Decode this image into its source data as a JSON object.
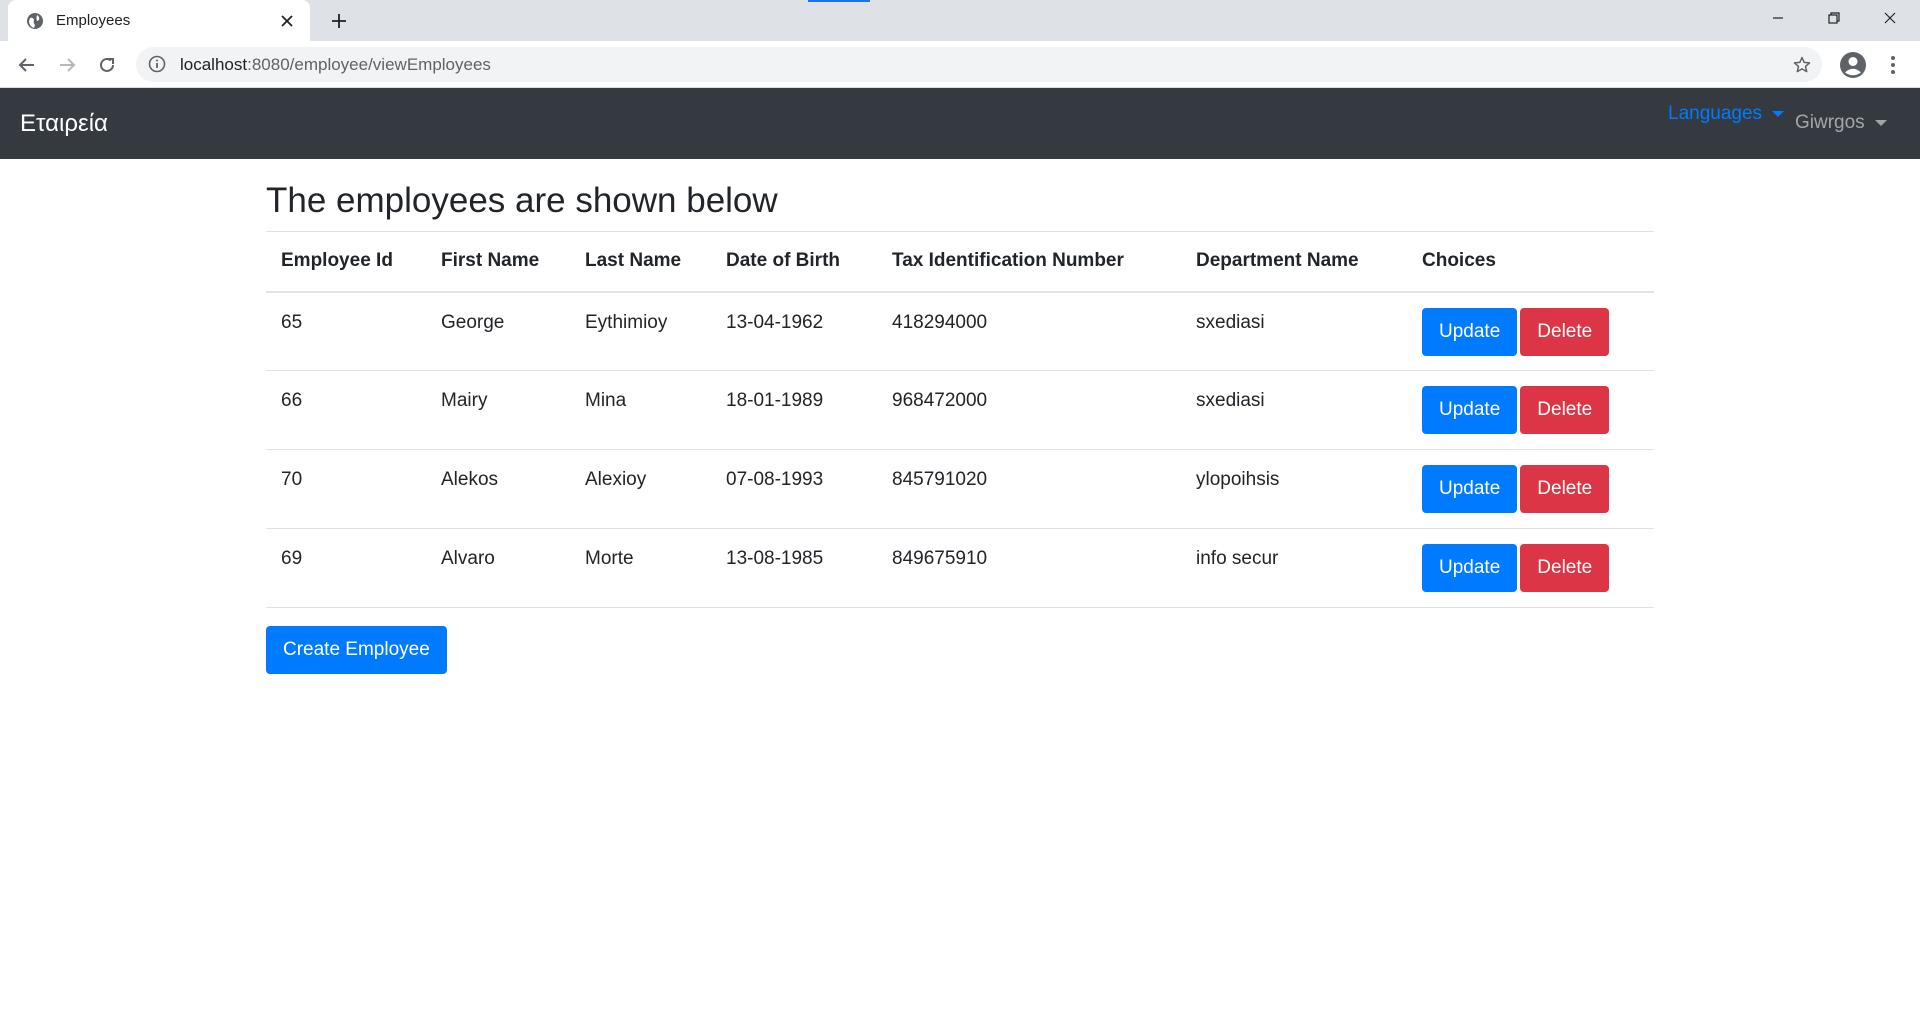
{
  "browser": {
    "tab_title": "Employees",
    "url_host": "localhost",
    "url_rest": ":8080/employee/viewEmployees",
    "accent": "#1a73e8"
  },
  "navbar": {
    "brand": "Εταιρεία",
    "languages": "Languages",
    "user": "Giwrgos",
    "background": "#343a40"
  },
  "page": {
    "title": "The employees are shown below",
    "create_label": "Create Employee"
  },
  "table": {
    "headers": [
      "Employee Id",
      "First Name",
      "Last Name",
      "Date of Birth",
      "Tax Identification Number",
      "Department Name",
      "Choices"
    ],
    "rows": [
      {
        "id": "65",
        "first": "George",
        "last": "Eythimioy",
        "dob": "13-04-1962",
        "tin": "418294000",
        "dept": "sxediasi"
      },
      {
        "id": "66",
        "first": "Mairy",
        "last": "Mina",
        "dob": "18-01-1989",
        "tin": "968472000",
        "dept": "sxediasi"
      },
      {
        "id": "70",
        "first": "Alekos",
        "last": "Alexioy",
        "dob": "07-08-1993",
        "tin": "845791020",
        "dept": "ylopoihsis"
      },
      {
        "id": "69",
        "first": "Alvaro",
        "last": "Morte",
        "dob": "13-08-1985",
        "tin": "849675910",
        "dept": "info secur"
      }
    ],
    "update_label": "Update",
    "delete_label": "Delete",
    "primary_color": "#007bff",
    "danger_color": "#dc3545"
  }
}
